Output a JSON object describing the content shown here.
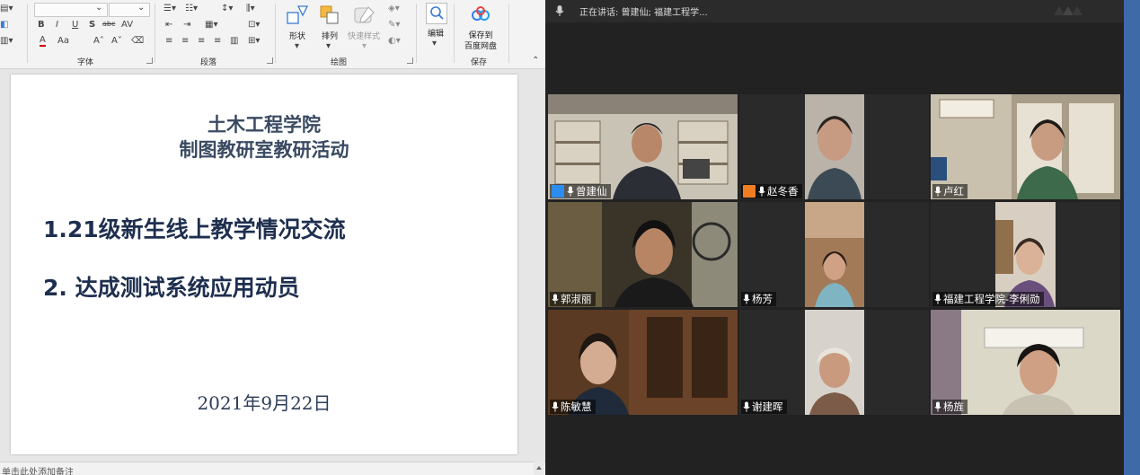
{
  "ribbon": {
    "groups": {
      "font": "字体",
      "paragraph": "段落",
      "drawing": "绘图",
      "save": "保存"
    },
    "buttons": {
      "shape": "形状",
      "arrange": "排列",
      "quick_style": "快速样式",
      "edit": "编辑",
      "save_to_line1": "保存到",
      "save_to_line2": "百度网盘"
    },
    "format_glyphs": {
      "bold": "B",
      "italic": "I",
      "underline": "U",
      "shadow": "S",
      "strikethrough": "abc",
      "font_color": "A"
    }
  },
  "slide": {
    "title_line1": "土木工程学院",
    "title_line2": "制图教研室教研活动",
    "item1": "1.21级新生线上教学情况交流",
    "item2": "2.  达成测试系统应用动员",
    "date": "2021年9月22日"
  },
  "notes": {
    "placeholder": "单击此处添加备注"
  },
  "meeting": {
    "speaking": "正在讲话: 曾建仙; 福建工程学...",
    "participants": [
      {
        "name": "曾建仙",
        "host": true,
        "host_color": "#2d8cf0",
        "active": true
      },
      {
        "name": "赵冬香",
        "host": true,
        "host_color": "#f07d22",
        "active": false
      },
      {
        "name": "卢红",
        "host": false,
        "active": false
      },
      {
        "name": "郭淑丽",
        "host": false,
        "active": false
      },
      {
        "name": "杨芳",
        "host": false,
        "active": false
      },
      {
        "name": "福建工程学院-李俐勋",
        "host": false,
        "active": false
      },
      {
        "name": "陈敏慧",
        "host": false,
        "active": false
      },
      {
        "name": "谢建晖",
        "host": false,
        "active": false
      },
      {
        "name": "杨旌",
        "host": false,
        "active": false
      }
    ]
  },
  "colors": {
    "active_border": "#27b24a",
    "accent_blue": "#3f6aa8",
    "slide_text": "#1e2f4f"
  }
}
